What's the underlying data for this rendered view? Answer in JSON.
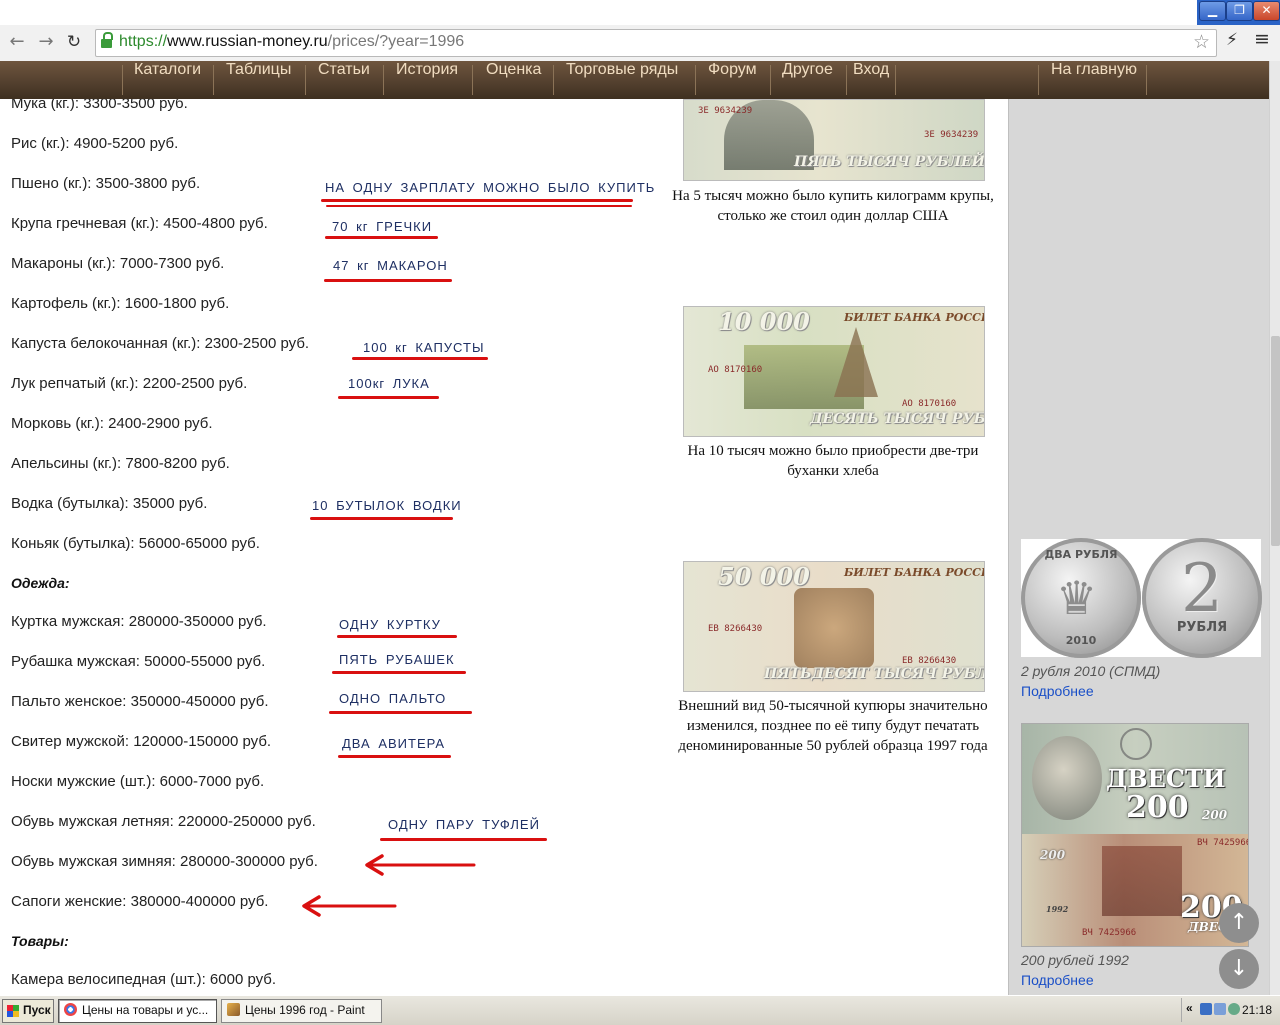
{
  "window": {
    "minimize": "▁",
    "maximize": "❐",
    "close": "✕"
  },
  "browser": {
    "url_scheme": "https://",
    "url_host": "www.russian-money.ru",
    "url_path": "/prices/?year=1996",
    "back_glyph": "←",
    "forward_glyph": "→",
    "reload_glyph": "↻",
    "star_glyph": "☆",
    "ext_glyph": "⚡",
    "menu_glyph": "≡"
  },
  "sitenav": {
    "items": [
      "Каталоги",
      "Таблицы",
      "Статьи",
      "История",
      "Оценка",
      "Торговые ряды",
      "Форум",
      "Другое",
      "Вход"
    ],
    "home": "На главную"
  },
  "prices": [
    "Мука (кг.): 3300-3500 руб.",
    "Рис (кг.): 4900-5200 руб.",
    "Пшено (кг.): 3500-3800 руб.",
    "Крупа гречневая (кг.): 4500-4800 руб.",
    "Макароны (кг.): 7000-7300 руб.",
    "Картофель (кг.): 1600-1800 руб.",
    "Капуста белокочанная (кг.): 2300-2500 руб.",
    "Лук репчатый (кг.): 2200-2500 руб.",
    "Морковь (кг.): 2400-2900 руб.",
    "Апельсины (кг.): 7800-8200 руб.",
    "Водка (бутылка): 35000 руб.",
    "Коньяк (бутылка): 56000-65000 руб.",
    "Куртка мужская: 280000-350000 руб.",
    "Рубашка мужская: 50000-55000 руб.",
    "Пальто женское: 350000-450000 руб.",
    "Свитер мужской: 120000-150000 руб.",
    "Носки мужские (шт.): 6000-7000 руб.",
    "Обувь мужская летняя: 220000-250000 руб.",
    "Обувь мужская зимняя: 280000-300000 руб.",
    "Сапоги женские: 380000-400000 руб.",
    "Камера велосипедная (шт.): 6000 руб."
  ],
  "sections": [
    "Одежда:",
    "Товары:"
  ],
  "annotations": [
    "НА ОДНУ ЗАРПЛАТУ МОЖНО БЫЛО КУПИТЬ",
    "70 кг ГРЕЧКИ",
    "47 кг МАКАРОН",
    "100 кг КАПУСТЫ",
    "100кг ЛУКА",
    "10 БУТЫЛОК ВОДКИ",
    "ОДНУ КУРТКУ",
    "ПЯТЬ РУБАШЕК",
    "ОДНО ПАЛЬТО",
    "ДВА АВИТЕРА",
    "ОДНУ ПАРУ ТУФЛЕЙ"
  ],
  "banknotes": [
    {
      "serial": "ЗЕ 9634239",
      "denomination_text": "ПЯТЬ ТЫСЯЧ РУБЛЕЙ",
      "caption": "На 5 тысяч можно было купить килограмм крупы, столько же стоил один доллар США"
    },
    {
      "bank": "БИЛЕТ БАНКА РОССИИ",
      "value": "10 000",
      "serial": "АО 8170160",
      "denomination_text": "ДЕСЯТЬ ТЫСЯЧ РУБЛЕЙ",
      "caption": "На 10 тысяч можно было приобрести две-три буханки хлеба"
    },
    {
      "bank": "БИЛЕТ БАНКА РОССИИ",
      "value": "50 000",
      "serial": "ЕВ 8266430",
      "denomination_text": "ПЯТЬДЕСЯТ ТЫСЯЧ РУБЛЕЙ",
      "caption": "Внешний вид 50-тысячной купюры значительно изменился, позднее по её типу будут печатать деноминированные 50 рублей образца 1997 года"
    }
  ],
  "sidebar": {
    "coin": {
      "obverse_text": "ДВА РУБЛЯ",
      "year": "2010",
      "numeral": "2",
      "reverse_text": "РУБЛЯ",
      "caption": "2 рубля 2010 (СПМД)",
      "link": "Подробнее"
    },
    "note200": {
      "word": "ДВЕСТИ",
      "value": "200",
      "small_word": "200",
      "year": "1992",
      "serial": "ВЧ 7425966",
      "back_value": "200",
      "back_word": "ДВЕСТИ",
      "caption": "200 рублей 1992",
      "link": "Подробнее"
    },
    "scroll_up": "↑",
    "scroll_down": "↓"
  },
  "taskbar": {
    "start": "Пуск",
    "tasks": [
      "Цены на товары и ус...",
      "Цены 1996 год - Paint"
    ],
    "tray_toggle": "«",
    "clock": "21:18"
  }
}
